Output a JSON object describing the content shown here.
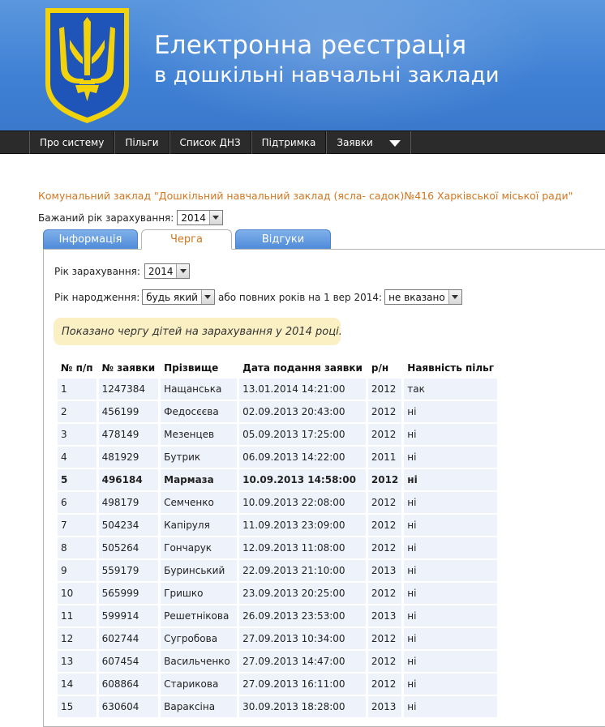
{
  "header": {
    "title_line1": "Електронна реєстрація",
    "title_line2": "в дошкільні навчальні заклади",
    "colors": {
      "header_blue": "#3f80d4",
      "emblem_blue": "#1f55b8",
      "emblem_gold": "#f2d20a"
    }
  },
  "nav": {
    "items": [
      "Про систему",
      "Пільги",
      "Список ДНЗ",
      "Підтримка",
      "Заявки"
    ]
  },
  "school": {
    "name": "Комунальний заклад \"Дошкільний навчальний заклад (ясла- садок)№416 Харківської міської ради\"",
    "desired_year_label": "Бажаний рік зарахування:",
    "desired_year_value": "2014"
  },
  "tabs": [
    {
      "label": "Інформація",
      "active": false
    },
    {
      "label": "Черга",
      "active": true
    },
    {
      "label": "Відгуки",
      "active": false
    }
  ],
  "filters": {
    "year_label": "Рік зарахування:",
    "year_value": "2014",
    "birth_label": "Рік народження:",
    "birth_value": "будь який",
    "or_full_years_label": "або повних років на 1 вер 2014:",
    "full_years_value": "не вказано"
  },
  "notice": "Показано чергу дітей на зарахування у 2014 році.",
  "table": {
    "headers": [
      "№ п/п",
      "№ заявки",
      "Прізвище",
      "Дата подання заявки",
      "р/н",
      "Наявність пільг"
    ],
    "rows": [
      [
        "1",
        "1247384",
        "Нащанська",
        "13.01.2014 14:21:00",
        "2012",
        "так"
      ],
      [
        "2",
        "456199",
        "Федосєєва",
        "02.09.2013 20:43:00",
        "2012",
        "ні"
      ],
      [
        "3",
        "478149",
        "Мезенцев",
        "05.09.2013 17:25:00",
        "2012",
        "ні"
      ],
      [
        "4",
        "481929",
        "Бутрик",
        "06.09.2013 14:22:00",
        "2011",
        "ні"
      ],
      [
        "5",
        "496184",
        "Мармаза",
        "10.09.2013 14:58:00",
        "2012",
        "ні"
      ],
      [
        "6",
        "498179",
        "Семченко",
        "10.09.2013 22:08:00",
        "2012",
        "ні"
      ],
      [
        "7",
        "504234",
        "Капіруля",
        "11.09.2013 23:09:00",
        "2012",
        "ні"
      ],
      [
        "8",
        "505264",
        "Гончарук",
        "12.09.2013 11:08:00",
        "2012",
        "ні"
      ],
      [
        "9",
        "559179",
        "Буринський",
        "22.09.2013 21:10:00",
        "2013",
        "ні"
      ],
      [
        "10",
        "565999",
        "Гришко",
        "23.09.2013 20:25:00",
        "2012",
        "ні"
      ],
      [
        "11",
        "599914",
        "Решетнікова",
        "26.09.2013 23:53:00",
        "2013",
        "ні"
      ],
      [
        "12",
        "602744",
        "Сугробова",
        "27.09.2013 10:34:00",
        "2012",
        "ні"
      ],
      [
        "13",
        "607454",
        "Васильченко",
        "27.09.2013 14:47:00",
        "2012",
        "ні"
      ],
      [
        "14",
        "608864",
        "Старикова",
        "27.09.2013 16:11:00",
        "2012",
        "ні"
      ],
      [
        "15",
        "630604",
        "Вараксіна",
        "30.09.2013 18:28:00",
        "2013",
        "ні"
      ]
    ],
    "highlighted_row": 5
  }
}
